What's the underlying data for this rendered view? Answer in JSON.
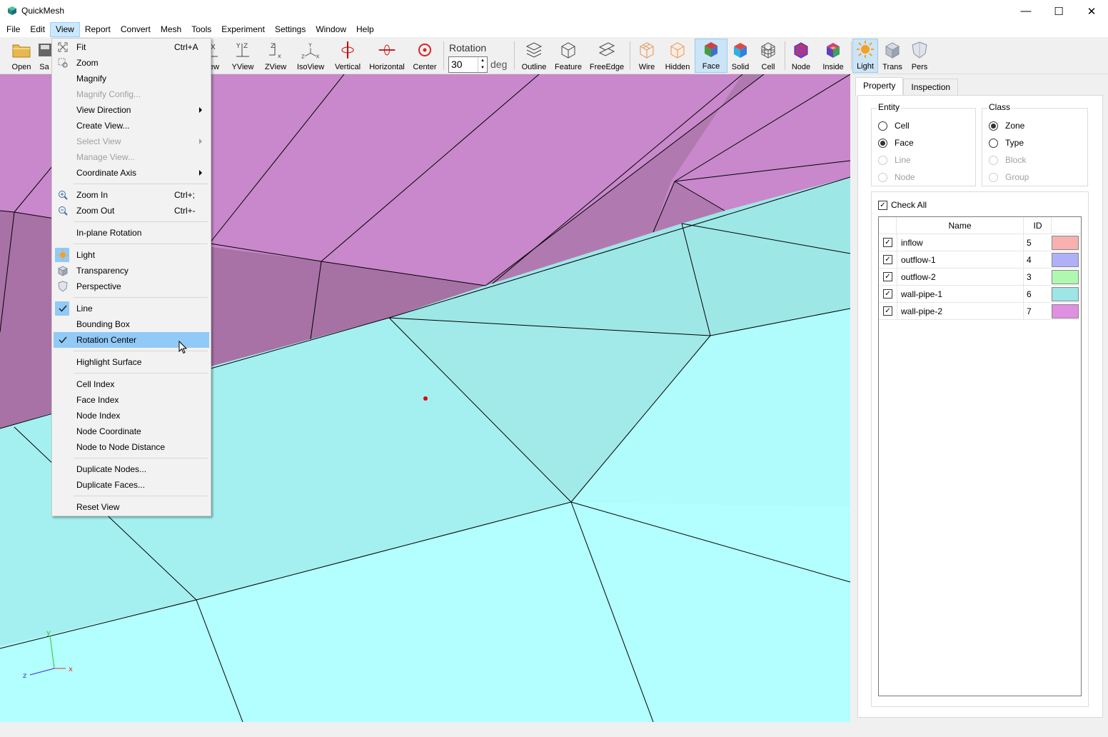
{
  "window": {
    "title": "QuickMesh",
    "minimize": "—",
    "maximize": "☐",
    "close": "✕"
  },
  "menubar": [
    "File",
    "Edit",
    "View",
    "Report",
    "Convert",
    "Mesh",
    "Tools",
    "Experiment",
    "Settings",
    "Window",
    "Help"
  ],
  "toolbar": {
    "open": "Open",
    "save_partial": "Sa",
    "view_partial": "ew",
    "yview": "YView",
    "zview": "ZView",
    "isoview": "IsoView",
    "vertical": "Vertical",
    "horizontal": "Horizontal",
    "center": "Center",
    "rotation_label": "Rotation",
    "rotation_value": "30",
    "rotation_unit": "deg",
    "outline": "Outline",
    "feature": "Feature",
    "freeedge": "FreeEdge",
    "wire": "Wire",
    "hidden": "Hidden",
    "face": "Face",
    "solid": "Solid",
    "cell": "Cell",
    "node": "Node",
    "inside": "Inside",
    "light": "Light",
    "trans": "Trans",
    "pers": "Pers"
  },
  "view_menu": {
    "fit": "Fit",
    "fit_shortcut": "Ctrl+A",
    "zoom": "Zoom",
    "magnify": "Magnify",
    "magnify_config": "Magnify Config...",
    "view_direction": "View Direction",
    "create_view": "Create View...",
    "select_view": "Select View",
    "manage_view": "Manage View...",
    "coordinate_axis": "Coordinate Axis",
    "zoom_in": "Zoom In",
    "zoom_in_shortcut": "Ctrl+;",
    "zoom_out": "Zoom Out",
    "zoom_out_shortcut": "Ctrl+-",
    "inplane_rotation": "In-plane Rotation",
    "light": "Light",
    "transparency": "Transparency",
    "perspective": "Perspective",
    "line": "Line",
    "bounding_box": "Bounding Box",
    "rotation_center": "Rotation Center",
    "highlight_surface": "Highlight Surface",
    "cell_index": "Cell Index",
    "face_index": "Face Index",
    "node_index": "Node Index",
    "node_coordinate": "Node Coordinate",
    "node_to_node_distance": "Node to Node Distance",
    "duplicate_nodes": "Duplicate Nodes...",
    "duplicate_faces": "Duplicate Faces...",
    "reset_view": "Reset View"
  },
  "axes": {
    "y": "y",
    "z": "z",
    "x": "x"
  },
  "panel": {
    "tabs": [
      "Property",
      "Inspection"
    ],
    "active_tab": "Property",
    "entity": {
      "title": "Entity",
      "options": [
        "Cell",
        "Face",
        "Line",
        "Node"
      ],
      "selected": "Face"
    },
    "class": {
      "title": "Class",
      "options": [
        "Zone",
        "Type",
        "Block",
        "Group"
      ],
      "selected": "Zone"
    },
    "check_all": "Check All",
    "table_headers": [
      "Name",
      "ID"
    ],
    "zones": [
      {
        "name": "inflow",
        "id": "5",
        "color": "#f8b0b0"
      },
      {
        "name": "outflow-1",
        "id": "4",
        "color": "#b0b0f8"
      },
      {
        "name": "outflow-2",
        "id": "3",
        "color": "#b0f8b0"
      },
      {
        "name": "wall-pipe-1",
        "id": "6",
        "color": "#9ee5e5"
      },
      {
        "name": "wall-pipe-2",
        "id": "7",
        "color": "#e090e0"
      }
    ]
  }
}
